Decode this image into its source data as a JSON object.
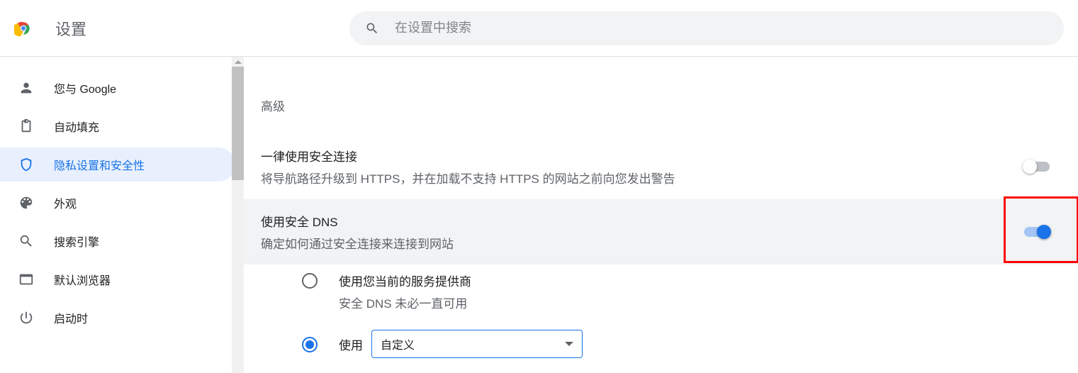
{
  "header": {
    "title": "设置",
    "search_placeholder": "在设置中搜索"
  },
  "sidebar": {
    "items": [
      {
        "label": "您与 Google",
        "icon": "person-icon",
        "active": false
      },
      {
        "label": "自动填充",
        "icon": "clipboard-icon",
        "active": false
      },
      {
        "label": "隐私设置和安全性",
        "icon": "shield-icon",
        "active": true
      },
      {
        "label": "外观",
        "icon": "palette-icon",
        "active": false
      },
      {
        "label": "搜索引擎",
        "icon": "search-icon",
        "active": false
      },
      {
        "label": "默认浏览器",
        "icon": "browser-icon",
        "active": false
      },
      {
        "label": "启动时",
        "icon": "power-icon",
        "active": false
      }
    ]
  },
  "main": {
    "section_heading": "高级",
    "settings": [
      {
        "title": "一律使用安全连接",
        "desc": "将导航路径升级到 HTTPS，并在加载不支持 HTTPS 的网站之前向您发出警告",
        "toggle": "off",
        "highlighted": false
      },
      {
        "title": "使用安全 DNS",
        "desc": "确定如何通过安全连接来连接到网站",
        "toggle": "on",
        "highlighted": true,
        "red_box": true
      }
    ],
    "dns_options": [
      {
        "selected": false,
        "label": "使用您当前的服务提供商",
        "sub": "安全 DNS 未必一直可用"
      },
      {
        "selected": true,
        "label": "使用",
        "select_value": "自定义"
      }
    ]
  }
}
